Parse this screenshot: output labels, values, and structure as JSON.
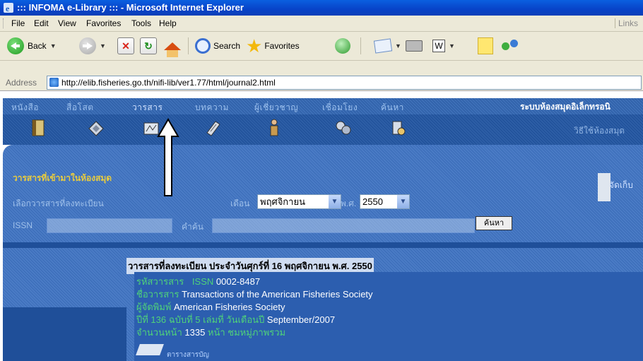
{
  "window": {
    "title": "::: INFOMA e-Library ::: - Microsoft Internet Explorer"
  },
  "menu": {
    "items": [
      "File",
      "Edit",
      "View",
      "Favorites",
      "Tools",
      "Help"
    ],
    "links_label": "Links"
  },
  "toolbar": {
    "back_label": "Back",
    "search_label": "Search",
    "favorites_label": "Favorites"
  },
  "address": {
    "label": "Address",
    "url": "http://elib.fisheries.go.th/nifi-lib/ver1.77/html/journal2.html"
  },
  "site": {
    "nav_tabs": [
      "หนังสือ",
      "สื่อโสต",
      "วารสาร",
      "บทความ",
      "ผู้เชี่ยวชาญ",
      "เชื่อมโยง",
      "ค้นหา"
    ],
    "active_tab": 2,
    "system_title": "ระบบห้องสมุดอิเล็กทรอนิ",
    "version_hint": "วิธีใช้ห้องสมุด",
    "section_title": "วารสารที่เข้ามาในห้องสมุด",
    "filter_label": "เลือกวารสารที่ลงทะเบียน",
    "month_label": "เดือน",
    "month_value": "พฤศจิกายน",
    "year_label": "พ.ศ.",
    "year_value": "2550",
    "issn_label": "ISSN",
    "keyword_label": "คำค้น",
    "search_button": "ค้นหา",
    "corner_text": "จัดเก็บ",
    "result_heading": "วารสารที่ลงทะเบียน ประจำวันศุกร์ที่ 16 พฤศจิกายน พ.ศ. 2550",
    "result": {
      "id_label": "รหัสวารสาร",
      "issn_label": "ISSN",
      "issn_value": "0002-8487",
      "title_label": "ชื่อวารสาร",
      "title_value": "Transactions of the American Fisheries Society",
      "publisher_label": "ผู้จัดพิมพ์",
      "publisher_value": "American Fisheries Society",
      "issue_text": "ปีที่ 136  ฉบับที่ 5  เล่มที่  วันเดือนปี",
      "issue_date": "September/2007",
      "pages_label": "จำนวนหน้า",
      "pages_value": "1335",
      "pages_suffix": "หน้า  ชมหมู่ภาพรวม",
      "doc_label": "ตารางสารบัญ"
    }
  },
  "colors": {
    "title_bar": "#0843c8",
    "chrome": "#ece9d8",
    "site_blue": "#3a6cb8",
    "accent_yellow": "#e9cc3e",
    "label_green": "#4fd27a"
  }
}
